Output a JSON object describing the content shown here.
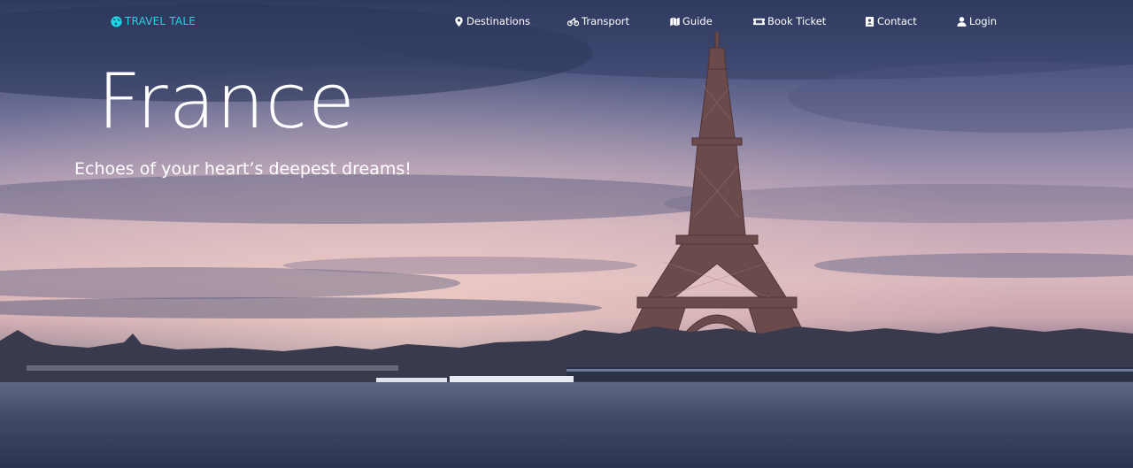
{
  "brand": {
    "name": "TRAVEL TALE",
    "icon": "globe-icon",
    "color": "#21d4e6"
  },
  "nav": {
    "items": [
      {
        "label": "Destinations",
        "icon": "map-marker-icon"
      },
      {
        "label": "Transport",
        "icon": "motorcycle-icon"
      },
      {
        "label": "Guide",
        "icon": "map-icon"
      },
      {
        "label": "Book Ticket",
        "icon": "ticket-icon"
      },
      {
        "label": "Contact",
        "icon": "address-card-icon"
      },
      {
        "label": "Login",
        "icon": "user-icon"
      }
    ]
  },
  "hero": {
    "title": "France",
    "subtitle": "Echoes of your heart’s deepest dreams!"
  }
}
